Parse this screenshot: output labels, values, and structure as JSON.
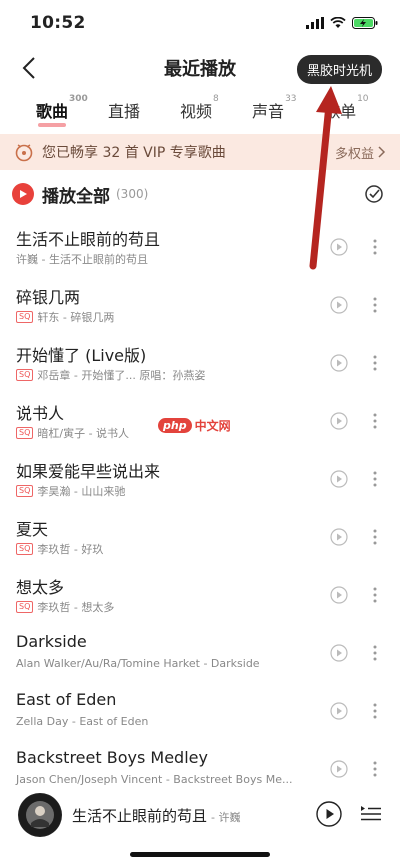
{
  "status": {
    "time": "10:52"
  },
  "nav": {
    "title": "最近播放",
    "vinyl_button": "黑胶时光机"
  },
  "tabs": [
    {
      "label": "歌曲",
      "count": "300"
    },
    {
      "label": "直播",
      "count": ""
    },
    {
      "label": "视频",
      "count": "8"
    },
    {
      "label": "声音",
      "count": "33"
    },
    {
      "label": "歌单",
      "count": "10"
    }
  ],
  "vip": {
    "text": "您已畅享 32 首 VIP 专享歌曲",
    "right": "多权益"
  },
  "playall": {
    "label": "播放全部",
    "count": "(300)"
  },
  "songs": [
    {
      "title": "生活不止眼前的苟且",
      "sq": "",
      "sub": "许巍 - 生活不止眼前的苟且"
    },
    {
      "title": "碎银几两",
      "sq": "SQ",
      "sub": "轩东 - 碎银几两"
    },
    {
      "title": "开始懂了 (Live版)",
      "sq": "SQ",
      "sub": "邓岳章 - 开始懂了...  原唱：孙燕姿"
    },
    {
      "title": "说书人",
      "sq": "SQ",
      "sub": "暗杠/寅子 - 说书人"
    },
    {
      "title": "如果爱能早些说出来",
      "sq": "SQ",
      "sub": "李昊瀚 - 山山来驰"
    },
    {
      "title": "夏天",
      "sq": "SQ",
      "sub": "李玖哲 - 好玖"
    },
    {
      "title": "想太多",
      "sq": "SQ",
      "sub": "李玖哲 - 想太多"
    },
    {
      "title": "Darkside",
      "sq": "",
      "sub": "Alan Walker/Au/Ra/Tomine Harket - Darkside"
    },
    {
      "title": "East of Eden",
      "sq": "",
      "sub": "Zella Day - East of Eden"
    },
    {
      "title": "Backstreet Boys Medley",
      "sq": "",
      "sub": "Jason Chen/Joseph Vincent - Backstreet Boys Me..."
    }
  ],
  "now_playing": {
    "title": "生活不止眼前的苟且",
    "artist": "- 许巍"
  },
  "watermark": {
    "badge": "php",
    "text": "中文网"
  },
  "colors": {
    "accent": "#e8413b",
    "vip_bg": "#fbe9e1",
    "arrow": "#b52520"
  }
}
